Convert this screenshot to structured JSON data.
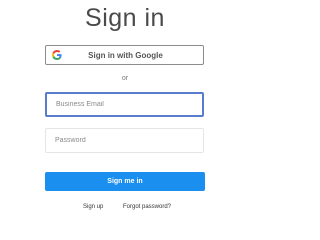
{
  "page": {
    "title": "Sign in"
  },
  "google_button": {
    "label": "Sign in with Google",
    "icon": "google-g-icon"
  },
  "separator": {
    "text": "or"
  },
  "form": {
    "email": {
      "placeholder": "Business Email",
      "value": ""
    },
    "password": {
      "placeholder": "Password",
      "value": ""
    },
    "submit_label": "Sign me in"
  },
  "links": {
    "signup": "Sign up",
    "forgot_password": "Forgot password?"
  },
  "colors": {
    "primary": "#1a8ff0",
    "focus_border": "#5a7ccc",
    "google_blue": "#4285F4",
    "google_red": "#EA4335",
    "google_yellow": "#FBBC05",
    "google_green": "#34A853"
  }
}
